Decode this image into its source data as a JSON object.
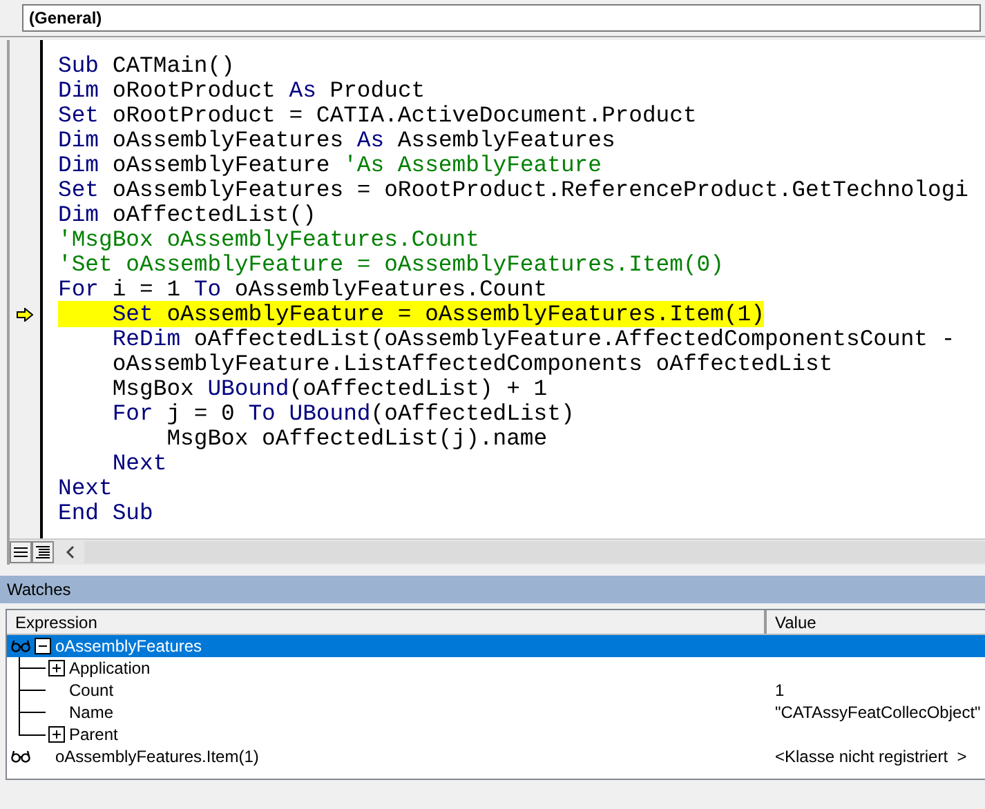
{
  "object_box": {
    "value": "(General)"
  },
  "code": {
    "lines": [
      {
        "current": false,
        "segments": [
          {
            "kind": "keyword",
            "text": "Sub"
          },
          {
            "kind": "plain",
            "text": " CATMain()"
          }
        ]
      },
      {
        "current": false,
        "segments": [
          {
            "kind": "keyword",
            "text": "Dim"
          },
          {
            "kind": "plain",
            "text": " oRootProduct "
          },
          {
            "kind": "keyword",
            "text": "As"
          },
          {
            "kind": "plain",
            "text": " Product"
          }
        ]
      },
      {
        "current": false,
        "segments": [
          {
            "kind": "keyword",
            "text": "Set"
          },
          {
            "kind": "plain",
            "text": " oRootProduct = CATIA.ActiveDocument.Product"
          }
        ]
      },
      {
        "current": false,
        "segments": [
          {
            "kind": "keyword",
            "text": "Dim"
          },
          {
            "kind": "plain",
            "text": " oAssemblyFeatures "
          },
          {
            "kind": "keyword",
            "text": "As"
          },
          {
            "kind": "plain",
            "text": " AssemblyFeatures"
          }
        ]
      },
      {
        "current": false,
        "segments": [
          {
            "kind": "keyword",
            "text": "Dim"
          },
          {
            "kind": "plain",
            "text": " oAssemblyFeature "
          },
          {
            "kind": "comment",
            "text": "'As AssemblyFeature"
          }
        ]
      },
      {
        "current": false,
        "segments": [
          {
            "kind": "keyword",
            "text": "Set"
          },
          {
            "kind": "plain",
            "text": " oAssemblyFeatures = oRootProduct.ReferenceProduct.GetTechnologi"
          }
        ]
      },
      {
        "current": false,
        "segments": [
          {
            "kind": "keyword",
            "text": "Dim"
          },
          {
            "kind": "plain",
            "text": " oAffectedList()"
          }
        ]
      },
      {
        "current": false,
        "segments": [
          {
            "kind": "comment",
            "text": "'MsgBox oAssemblyFeatures.Count"
          }
        ]
      },
      {
        "current": false,
        "segments": [
          {
            "kind": "comment",
            "text": "'Set oAssemblyFeature = oAssemblyFeatures.Item(0)"
          }
        ]
      },
      {
        "current": false,
        "segments": [
          {
            "kind": "keyword",
            "text": "For"
          },
          {
            "kind": "plain",
            "text": " i = 1 "
          },
          {
            "kind": "keyword",
            "text": "To"
          },
          {
            "kind": "plain",
            "text": " oAssemblyFeatures.Count"
          }
        ]
      },
      {
        "current": true,
        "segments": [
          {
            "kind": "keyword",
            "text": "    Set"
          },
          {
            "kind": "plain",
            "text": " oAssemblyFeature = oAssemblyFeatures.Item(1)"
          }
        ]
      },
      {
        "current": false,
        "segments": [
          {
            "kind": "keyword",
            "text": "    ReDim"
          },
          {
            "kind": "plain",
            "text": " oAffectedList(oAssemblyFeature.AffectedComponentsCount -"
          }
        ]
      },
      {
        "current": false,
        "segments": [
          {
            "kind": "plain",
            "text": "    oAssemblyFeature.ListAffectedComponents oAffectedList"
          }
        ]
      },
      {
        "current": false,
        "segments": [
          {
            "kind": "plain",
            "text": "    MsgBox "
          },
          {
            "kind": "keyword",
            "text": "UBound"
          },
          {
            "kind": "plain",
            "text": "(oAffectedList) + 1"
          }
        ]
      },
      {
        "current": false,
        "segments": [
          {
            "kind": "keyword",
            "text": "    For"
          },
          {
            "kind": "plain",
            "text": " j = 0 "
          },
          {
            "kind": "keyword",
            "text": "To"
          },
          {
            "kind": "keyword",
            "text": " UBound"
          },
          {
            "kind": "plain",
            "text": "(oAffectedList)"
          }
        ]
      },
      {
        "current": false,
        "segments": [
          {
            "kind": "plain",
            "text": "        MsgBox oAffectedList(j).name"
          }
        ]
      },
      {
        "current": false,
        "segments": [
          {
            "kind": "keyword",
            "text": "    Next"
          }
        ]
      },
      {
        "current": false,
        "segments": [
          {
            "kind": "keyword",
            "text": "Next"
          }
        ]
      },
      {
        "current": false,
        "segments": [
          {
            "kind": "keyword",
            "text": "End Sub"
          }
        ]
      }
    ]
  },
  "watches": {
    "title": "Watches",
    "columns": [
      "Expression",
      "Value"
    ],
    "rows": [
      {
        "kind": "object",
        "expression": "oAssemblyFeatures",
        "expanded": true,
        "selected": true,
        "children": [
          {
            "kind": "object",
            "expression": "Application",
            "expanded": false,
            "selected": false
          },
          {
            "kind": "property",
            "expression": "Count",
            "value": "1",
            "selected": false
          },
          {
            "kind": "property",
            "expression": "Name",
            "value": "\"CATAssyFeatCollecObject\"",
            "selected": false
          },
          {
            "kind": "object",
            "expression": "Parent",
            "expanded": false,
            "selected": false
          }
        ]
      },
      {
        "kind": "property",
        "expression": "oAssemblyFeatures.Item(1)",
        "value": "<Klasse nicht registriert  >",
        "selected": false
      }
    ]
  }
}
